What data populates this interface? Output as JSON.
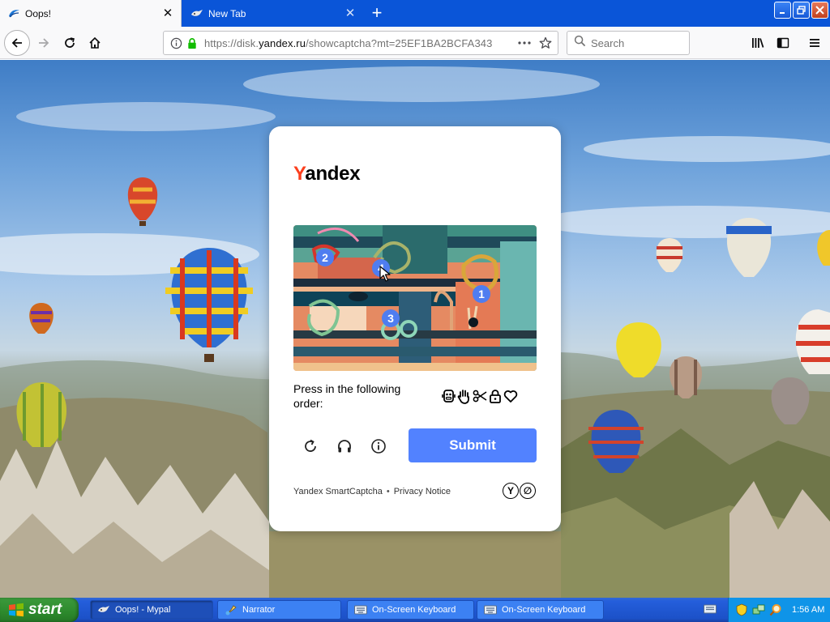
{
  "browser": {
    "tabs": [
      {
        "title": "Oops!",
        "active": true
      },
      {
        "title": "New Tab",
        "active": false
      }
    ],
    "url": {
      "prefix": "https://disk.",
      "domain": "yandex.ru",
      "path": "/showcaptcha?mt=25EF1BA2BCFA343"
    },
    "search_placeholder": "Search"
  },
  "captcha": {
    "brand": {
      "first_letter": "Y",
      "rest": "andex"
    },
    "markers": [
      "2",
      "4",
      "1",
      "3"
    ],
    "instruction": "Press in the following order:",
    "order_icons": [
      "robot-icon",
      "hand-icon",
      "scissors-icon",
      "lock-icon",
      "heart-icon"
    ],
    "submit_label": "Submit",
    "footer": {
      "smartcaptcha": "Yandex SmartCaptcha",
      "separator": "•",
      "privacy": "Privacy Notice"
    },
    "footer_logo": [
      "Y",
      "∅"
    ]
  },
  "taskbar": {
    "start_label": "start",
    "tasks": [
      {
        "label": "Oops! - Mypal",
        "icon": "mypal-icon",
        "active": true
      },
      {
        "label": "Narrator",
        "icon": "narrator-icon",
        "active": false
      },
      {
        "label": "On-Screen Keyboard",
        "icon": "keyboard-icon",
        "active": false
      },
      {
        "label": "On-Screen Keyboard",
        "icon": "keyboard-icon",
        "active": false
      }
    ],
    "clock": "1:56 AM"
  },
  "colors": {
    "titlebar": "#0a55d8",
    "yandex_red": "#fc3f1d",
    "submit_blue": "#5282ff",
    "marker_blue": "#4f7df0",
    "taskbar_blue": "#245edb",
    "start_green": "#2d8a2d"
  }
}
